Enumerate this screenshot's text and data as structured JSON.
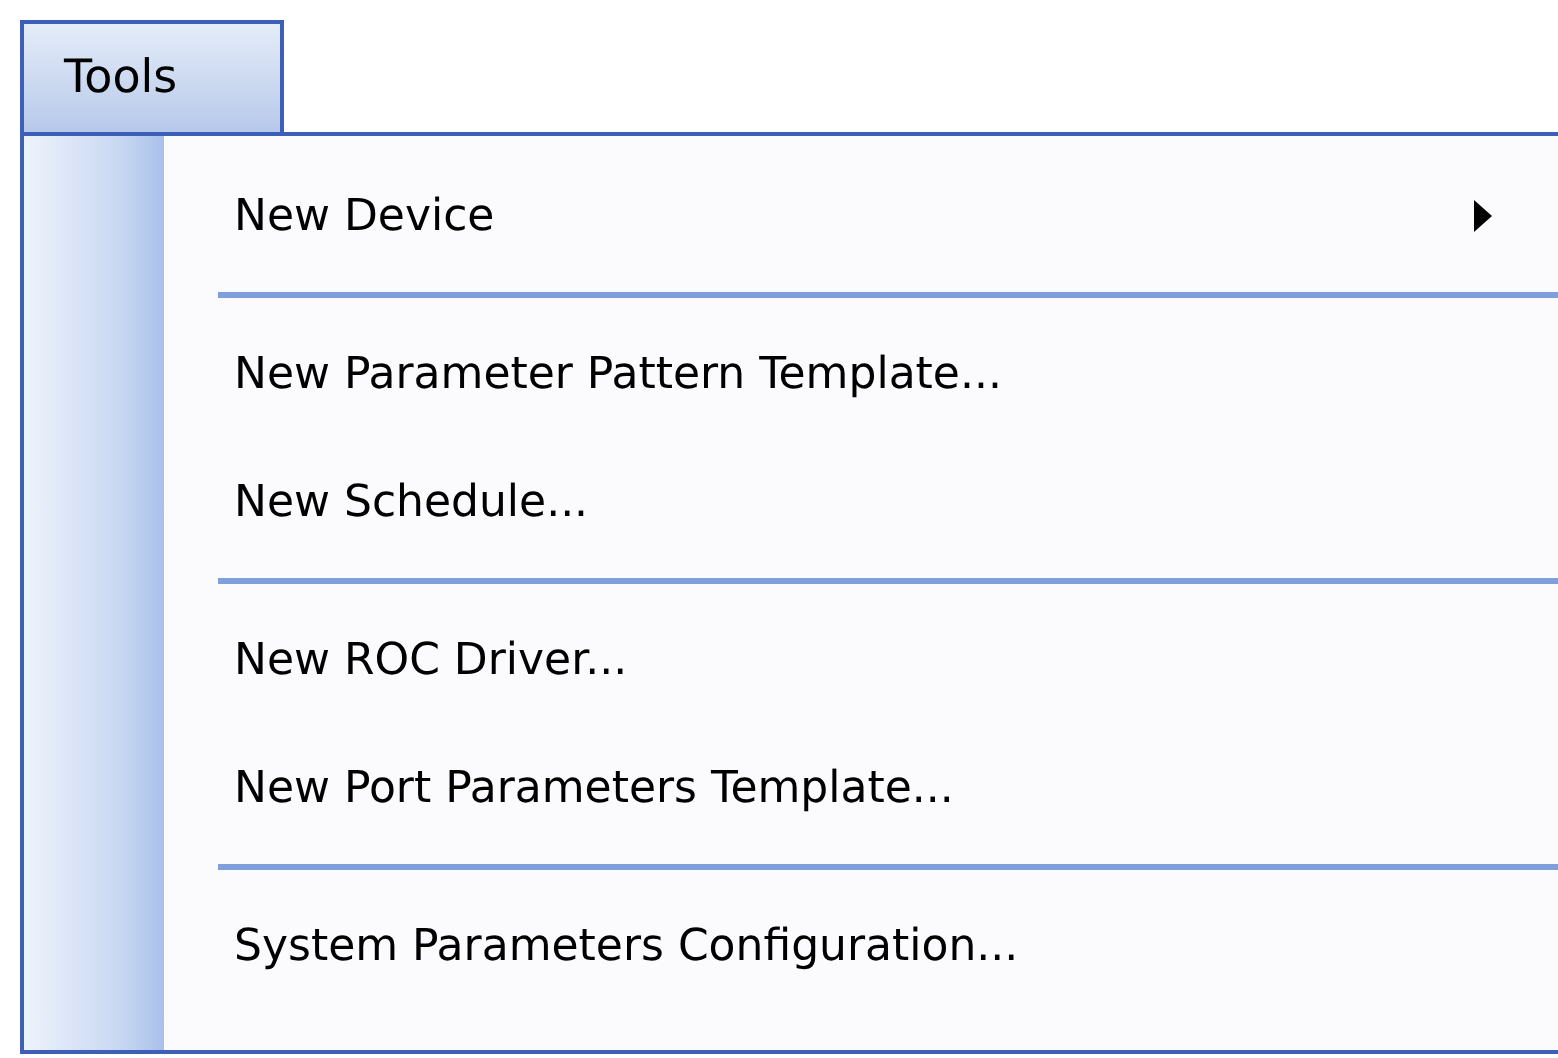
{
  "menu_bar": {
    "menu": {
      "label": "Tools",
      "selected": true
    }
  },
  "menu": {
    "items": [
      {
        "kind": "item",
        "label": "New Device",
        "has_submenu": true
      },
      {
        "kind": "separator"
      },
      {
        "kind": "item",
        "label": "New Parameter Pattern Template...",
        "has_submenu": false
      },
      {
        "kind": "item",
        "label": "New Schedule...",
        "has_submenu": false
      },
      {
        "kind": "separator"
      },
      {
        "kind": "item",
        "label": "New ROC Driver...",
        "has_submenu": false
      },
      {
        "kind": "item",
        "label": "New Port Parameters Template...",
        "has_submenu": false
      },
      {
        "kind": "separator"
      },
      {
        "kind": "item",
        "label": "System Parameters Configuration...",
        "has_submenu": false
      }
    ]
  }
}
